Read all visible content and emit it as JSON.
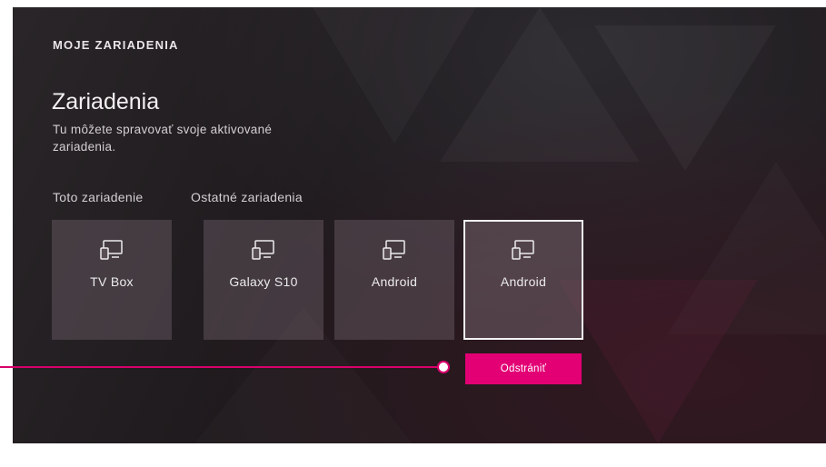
{
  "page": {
    "section_title": "MOJE ZARIADENIA",
    "heading": "Zariadenia",
    "description": "Tu môžete spravovať svoje aktivované zariadenia."
  },
  "groups": {
    "this_device_label": "Toto zariadenie",
    "other_devices_label": "Ostatné zariadenia"
  },
  "devices": [
    {
      "name": "TV Box",
      "icon": "devices-icon",
      "selected": false
    },
    {
      "name": "Galaxy S10",
      "icon": "devices-icon",
      "selected": false
    },
    {
      "name": "Android",
      "icon": "devices-icon",
      "selected": false
    },
    {
      "name": "Android",
      "icon": "devices-icon",
      "selected": true
    }
  ],
  "actions": {
    "remove_label": "Odstrániť"
  },
  "colors": {
    "accent": "#e20074",
    "background": "#1e1a1d",
    "tile": "#4a3f46"
  }
}
